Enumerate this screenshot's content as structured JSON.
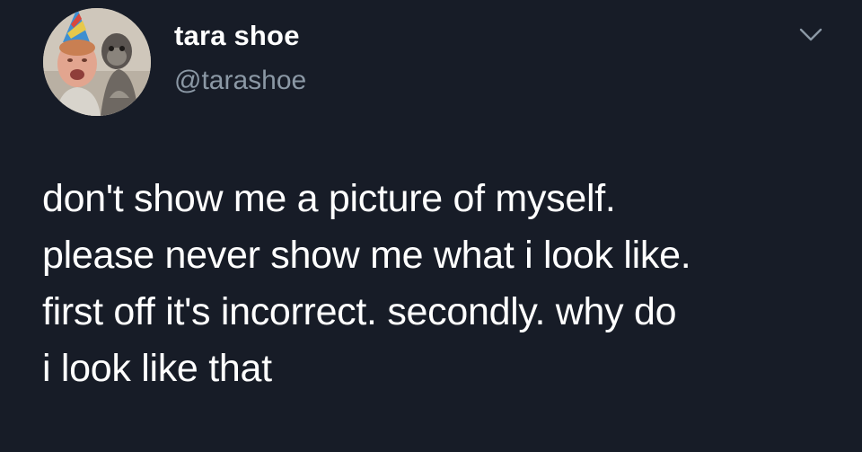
{
  "author": {
    "display_name": "tara shoe",
    "handle": "@tarashoe",
    "avatar_icon": "profile-photo-avatar"
  },
  "menu_icon": "chevron-down-icon",
  "tweet": {
    "lines": [
      "don't show me a picture of myself.",
      "please never show me what i look like.",
      "first off it's incorrect. secondly. why do",
      "i look like that"
    ]
  },
  "colors": {
    "background": "#171c27",
    "primary_text": "#ffffff",
    "secondary_text": "#8b98a5"
  }
}
